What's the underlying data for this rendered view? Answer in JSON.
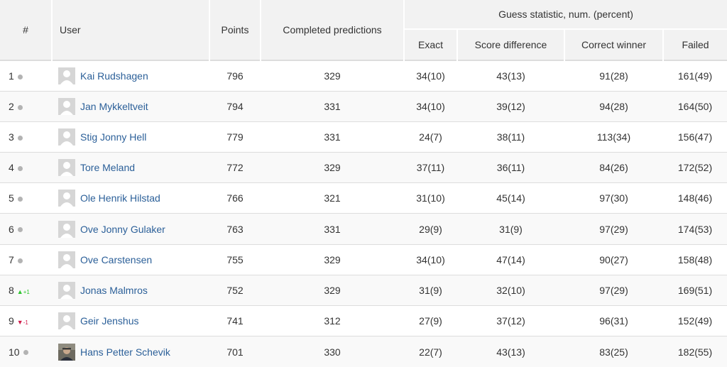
{
  "headers": {
    "rank": "#",
    "user": "User",
    "points": "Points",
    "completed": "Completed predictions",
    "group": "Guess statistic, num. (percent)",
    "exact": "Exact",
    "score_difference": "Score difference",
    "correct_winner": "Correct winner",
    "failed": "Failed"
  },
  "colors": {
    "link": "#2c6099",
    "up": "#2ec52e",
    "down": "#d01a4a",
    "neutral": "#b3b3b3"
  },
  "rows": [
    {
      "rank": "1",
      "change": "none",
      "change_text": "",
      "name": "Kai Rudshagen",
      "avatar": "default",
      "points": "796",
      "completed": "329",
      "exact": "34(10)",
      "score_difference": "43(13)",
      "correct_winner": "91(28)",
      "failed": "161(49)"
    },
    {
      "rank": "2",
      "change": "none",
      "change_text": "",
      "name": "Jan Mykkeltveit",
      "avatar": "default",
      "points": "794",
      "completed": "331",
      "exact": "34(10)",
      "score_difference": "39(12)",
      "correct_winner": "94(28)",
      "failed": "164(50)"
    },
    {
      "rank": "3",
      "change": "none",
      "change_text": "",
      "name": "Stig Jonny Hell",
      "avatar": "default",
      "points": "779",
      "completed": "331",
      "exact": "24(7)",
      "score_difference": "38(11)",
      "correct_winner": "113(34)",
      "failed": "156(47)"
    },
    {
      "rank": "4",
      "change": "none",
      "change_text": "",
      "name": "Tore Meland",
      "avatar": "default",
      "points": "772",
      "completed": "329",
      "exact": "37(11)",
      "score_difference": "36(11)",
      "correct_winner": "84(26)",
      "failed": "172(52)"
    },
    {
      "rank": "5",
      "change": "none",
      "change_text": "",
      "name": "Ole Henrik Hilstad",
      "avatar": "default",
      "points": "766",
      "completed": "321",
      "exact": "31(10)",
      "score_difference": "45(14)",
      "correct_winner": "97(30)",
      "failed": "148(46)"
    },
    {
      "rank": "6",
      "change": "none",
      "change_text": "",
      "name": "Ove Jonny Gulaker",
      "avatar": "default",
      "points": "763",
      "completed": "331",
      "exact": "29(9)",
      "score_difference": "31(9)",
      "correct_winner": "97(29)",
      "failed": "174(53)"
    },
    {
      "rank": "7",
      "change": "none",
      "change_text": "",
      "name": "Ove Carstensen",
      "avatar": "default",
      "points": "755",
      "completed": "329",
      "exact": "34(10)",
      "score_difference": "47(14)",
      "correct_winner": "90(27)",
      "failed": "158(48)"
    },
    {
      "rank": "8",
      "change": "up",
      "change_text": "+1",
      "name": "Jonas Malmros",
      "avatar": "default",
      "points": "752",
      "completed": "329",
      "exact": "31(9)",
      "score_difference": "32(10)",
      "correct_winner": "97(29)",
      "failed": "169(51)"
    },
    {
      "rank": "9",
      "change": "down",
      "change_text": "-1",
      "name": "Geir Jenshus",
      "avatar": "default",
      "points": "741",
      "completed": "312",
      "exact": "27(9)",
      "score_difference": "37(12)",
      "correct_winner": "96(31)",
      "failed": "152(49)"
    },
    {
      "rank": "10",
      "change": "none",
      "change_text": "",
      "name": "Hans Petter Schevik",
      "avatar": "photo",
      "points": "701",
      "completed": "330",
      "exact": "22(7)",
      "score_difference": "43(13)",
      "correct_winner": "83(25)",
      "failed": "182(55)"
    }
  ]
}
